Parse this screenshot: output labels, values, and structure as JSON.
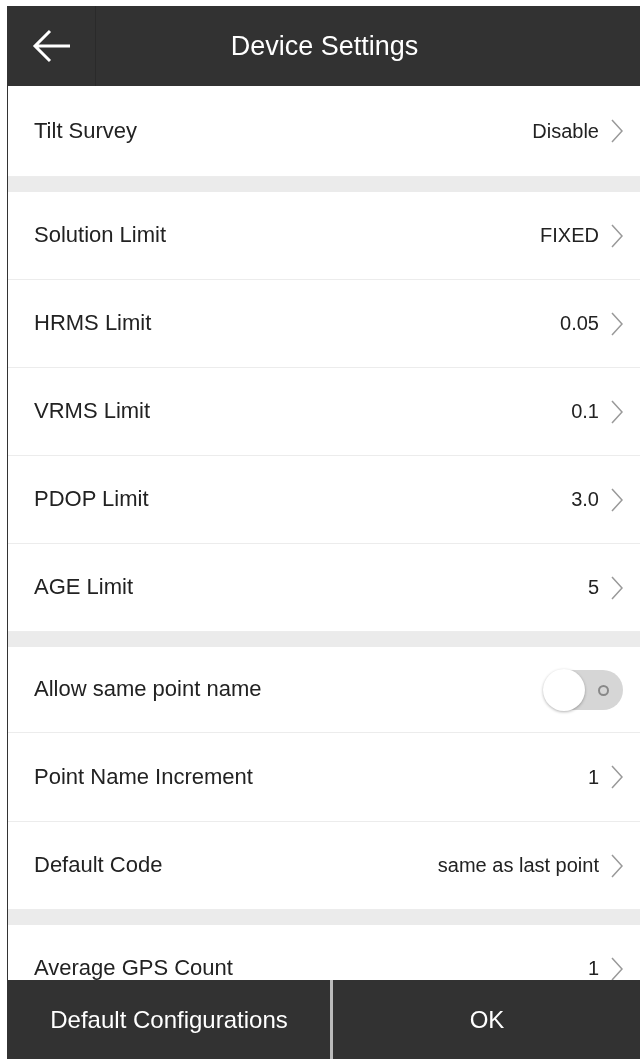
{
  "header": {
    "title": "Device Settings"
  },
  "groups": [
    [
      {
        "kind": "value",
        "label": "Tilt Survey",
        "value": "Disable"
      }
    ],
    [
      {
        "kind": "value",
        "label": "Solution Limit",
        "value": "FIXED"
      },
      {
        "kind": "value",
        "label": "HRMS Limit",
        "value": "0.05"
      },
      {
        "kind": "value",
        "label": "VRMS Limit",
        "value": "0.1"
      },
      {
        "kind": "value",
        "label": "PDOP Limit",
        "value": "3.0"
      },
      {
        "kind": "value",
        "label": "AGE Limit",
        "value": "5"
      }
    ],
    [
      {
        "kind": "toggle",
        "label": "Allow same point name",
        "on": false
      },
      {
        "kind": "value",
        "label": "Point Name Increment",
        "value": "1"
      },
      {
        "kind": "value",
        "label": "Default Code",
        "value": "same as last point"
      }
    ],
    [
      {
        "kind": "value",
        "label": "Average GPS Count",
        "value": "1"
      }
    ]
  ],
  "footer": {
    "buttons": [
      "Default Configurations",
      "OK"
    ]
  }
}
